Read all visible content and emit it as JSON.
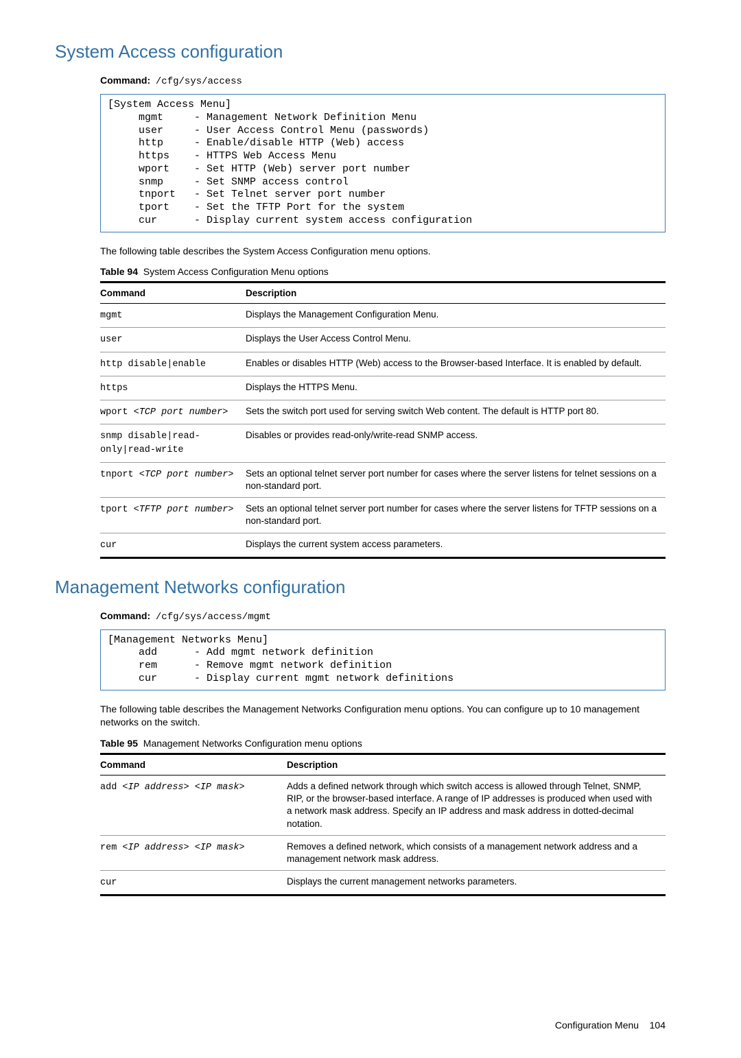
{
  "section1": {
    "title": "System Access configuration",
    "command_label": "Command:",
    "command_path": "/cfg/sys/access",
    "menu_title": "[System Access Menu]",
    "menu_items": [
      {
        "cmd": "mgmt",
        "desc": "Management Network Definition Menu"
      },
      {
        "cmd": "user",
        "desc": "User Access Control Menu (passwords)"
      },
      {
        "cmd": "http",
        "desc": "Enable/disable HTTP (Web) access"
      },
      {
        "cmd": "https",
        "desc": "HTTPS Web Access Menu"
      },
      {
        "cmd": "wport",
        "desc": "Set HTTP (Web) server port number"
      },
      {
        "cmd": "snmp",
        "desc": "Set SNMP access control"
      },
      {
        "cmd": "tnport",
        "desc": "Set Telnet server port number"
      },
      {
        "cmd": "tport",
        "desc": "Set the TFTP Port for the system"
      },
      {
        "cmd": "cur",
        "desc": "Display current system access configuration"
      }
    ],
    "body_text": "The following table describes the System Access Configuration menu options.",
    "table_label": "Table 94",
    "table_title": "System Access Configuration Menu options",
    "headers": {
      "col1": "Command",
      "col2": "Description"
    },
    "rows": [
      {
        "cmd_plain": "mgmt",
        "arg": "",
        "desc": "Displays the Management Configuration Menu."
      },
      {
        "cmd_plain": "user",
        "arg": "",
        "desc": "Displays the User Access Control Menu."
      },
      {
        "cmd_plain": "http disable|enable",
        "arg": "",
        "desc": "Enables or disables HTTP (Web) access to the Browser-based Interface. It is enabled by default."
      },
      {
        "cmd_plain": "https",
        "arg": "",
        "desc": "Displays the HTTPS Menu."
      },
      {
        "cmd_plain": "wport ",
        "arg": "<TCP port number>",
        "desc": "Sets the switch port used for serving switch Web content. The default is HTTP port 80."
      },
      {
        "cmd_plain": "snmp disable|read-only|read-write",
        "arg": "",
        "desc": "Disables or provides read-only/write-read SNMP access."
      },
      {
        "cmd_plain": "tnport ",
        "arg": "<TCP port number>",
        "desc": "Sets an optional telnet server port number for cases where the server listens for telnet sessions on a non-standard port."
      },
      {
        "cmd_plain": "tport ",
        "arg": "<TFTP port number>",
        "desc": "Sets an optional telnet server port number for cases where the server listens for TFTP sessions on a non-standard port."
      },
      {
        "cmd_plain": "cur",
        "arg": "",
        "desc": "Displays the current system access parameters."
      }
    ]
  },
  "section2": {
    "title": "Management Networks configuration",
    "command_label": "Command:",
    "command_path": "/cfg/sys/access/mgmt",
    "menu_title": "[Management Networks Menu]",
    "menu_items": [
      {
        "cmd": "add",
        "desc": "Add mgmt network definition"
      },
      {
        "cmd": "rem",
        "desc": "Remove mgmt network definition"
      },
      {
        "cmd": "cur",
        "desc": "Display current mgmt network definitions"
      }
    ],
    "body_text": "The following table describes the Management Networks Configuration menu options. You can configure up to 10 management networks on the switch.",
    "table_label": "Table 95",
    "table_title": "Management Networks Configuration menu options",
    "headers": {
      "col1": "Command",
      "col2": "Description"
    },
    "rows": [
      {
        "cmd_plain": "add ",
        "arg": "<IP address> <IP mask>",
        "desc": "Adds a defined network through which switch access is allowed through Telnet, SNMP, RIP, or the browser-based interface. A range of IP addresses is produced when used with a network mask address. Specify an IP address and mask address in dotted-decimal notation."
      },
      {
        "cmd_plain": "rem ",
        "arg": "<IP address> <IP mask>",
        "desc": "Removes a defined network, which consists of a management network address and a management network mask address."
      },
      {
        "cmd_plain": "cur",
        "arg": "",
        "desc": "Displays the current management networks parameters."
      }
    ]
  },
  "footer": {
    "text": "Configuration Menu",
    "page": "104"
  }
}
